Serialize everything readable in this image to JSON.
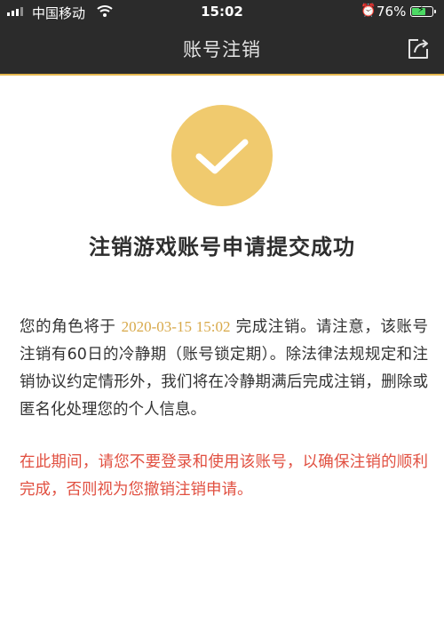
{
  "status_bar": {
    "carrier": "中国移动",
    "time": "15:02",
    "battery_percent_text": "76%",
    "battery_level": 0.76,
    "icons": [
      "signal-icon",
      "wifi-icon",
      "alarm-icon",
      "battery-charging-icon"
    ]
  },
  "nav": {
    "title": "账号注销",
    "share_icon": "share-icon"
  },
  "result": {
    "icon": "checkmark-icon",
    "icon_color": "#f0ca6e",
    "headline": "注销游戏账号申请提交成功"
  },
  "message": {
    "part1": "您的角色将于 ",
    "datetime": "2020-03-15 15:02",
    "part2": " 完成注销。请注意，该账号注销有60日的冷静期（账号锁定期）。除法律法规规定和注销协议约定情形外，我们将在冷静期满后完成注销，删除或匿名化处理您的个人信息。"
  },
  "warning": {
    "text": "在此期间，请您不要登录和使用该账号，以确保注销的顺利完成，否则视为您撤销注销申请。"
  },
  "colors": {
    "header_bg": "#2b2b2b",
    "accent": "#e4b74e",
    "highlight": "#d8a94a",
    "warning": "#e15041"
  }
}
